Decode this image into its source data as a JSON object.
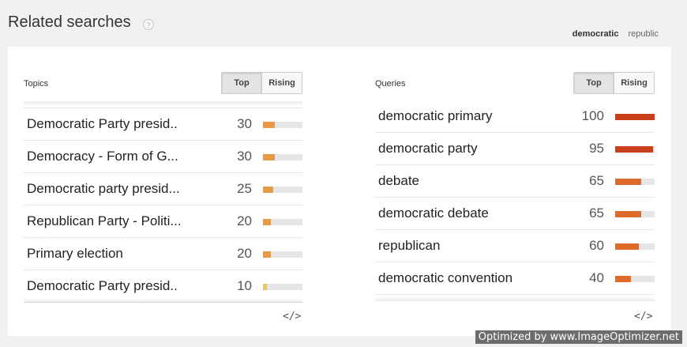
{
  "header": {
    "title": "Related searches",
    "help_icon": "?"
  },
  "term_tabs": [
    {
      "label": "democratic",
      "active": true
    },
    {
      "label": "republic",
      "active": false
    }
  ],
  "topics": {
    "title": "Topics",
    "toggle": [
      "Top",
      "Rising"
    ],
    "active_toggle": "Top",
    "rows": [
      {
        "label": "Democratic Party presid..",
        "value": "30",
        "fill": 0.3
      },
      {
        "label": "Democracy - Form of G...",
        "value": "30",
        "fill": 0.3
      },
      {
        "label": "Democratic party presid...",
        "value": "25",
        "fill": 0.25
      },
      {
        "label": "Republican Party - Politi...",
        "value": "20",
        "fill": 0.2
      },
      {
        "label": "Primary election",
        "value": "20",
        "fill": 0.2
      },
      {
        "label": "Democratic Party presid..",
        "value": "10",
        "fill": 0.1
      }
    ],
    "embed_icon": "</>"
  },
  "queries": {
    "title": "Queries",
    "toggle": [
      "Top",
      "Rising"
    ],
    "active_toggle": "Top",
    "rows": [
      {
        "label": "democratic primary",
        "value": "100",
        "fill": 1.0
      },
      {
        "label": "democratic party",
        "value": "95",
        "fill": 0.95
      },
      {
        "label": "debate",
        "value": "65",
        "fill": 0.65
      },
      {
        "label": "democratic debate",
        "value": "65",
        "fill": 0.65
      },
      {
        "label": "republican",
        "value": "60",
        "fill": 0.6
      },
      {
        "label": "democratic convention",
        "value": "40",
        "fill": 0.4
      }
    ],
    "embed_icon": "</>"
  },
  "colors": {
    "accent": "#4a84c4",
    "bar_high": "#c8411b",
    "bar_mid": "#e06a2a",
    "bar_low": "#e89a45",
    "bar_lowest": "#f2c45c"
  },
  "watermark": "Optimized by www.ImageOptimizer.net"
}
